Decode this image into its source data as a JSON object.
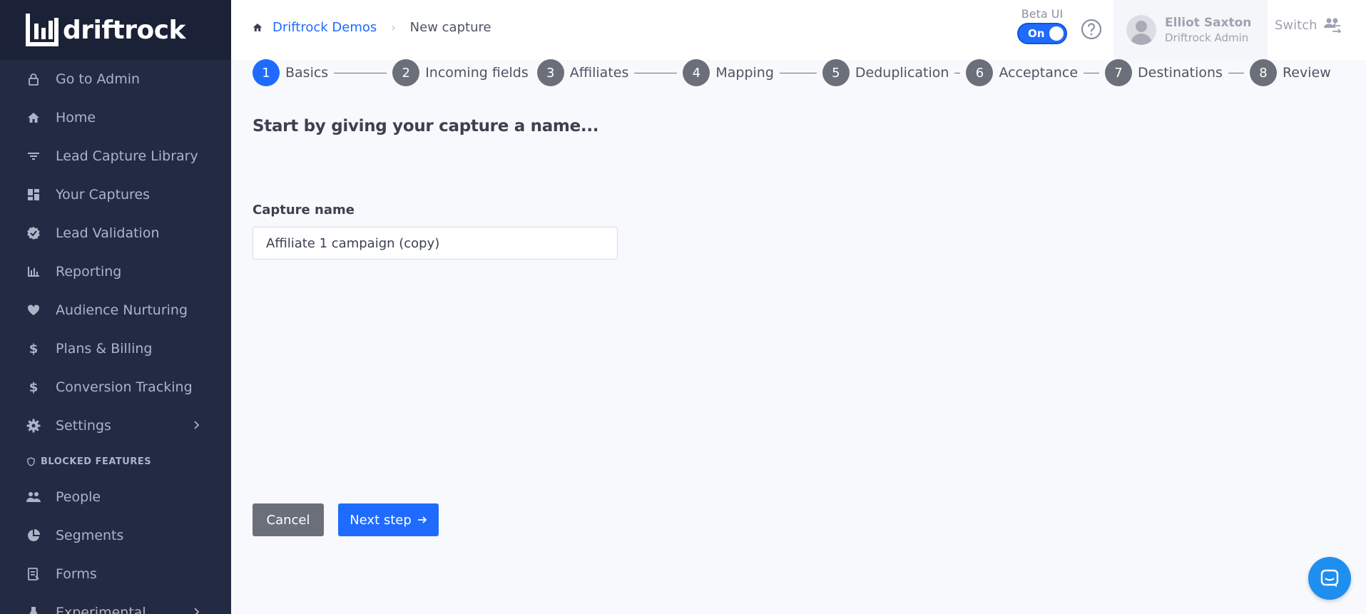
{
  "brand": {
    "name": "driftrock"
  },
  "sidebar": {
    "items": [
      {
        "label": "Go to Admin",
        "icon": "lock-icon"
      },
      {
        "label": "Home",
        "icon": "home-icon"
      },
      {
        "label": "Lead Capture Library",
        "icon": "filter-icon"
      },
      {
        "label": "Your Captures",
        "icon": "dashboard-icon"
      },
      {
        "label": "Lead Validation",
        "icon": "verified-icon"
      },
      {
        "label": "Reporting",
        "icon": "bar-chart-icon"
      },
      {
        "label": "Audience Nurturing",
        "icon": "heart-icon"
      },
      {
        "label": "Plans & Billing",
        "icon": "dollar-icon"
      },
      {
        "label": "Conversion Tracking",
        "icon": "dollar-icon"
      },
      {
        "label": "Settings",
        "icon": "gear-icon"
      }
    ],
    "section_label": "BLOCKED FEATURES",
    "blocked_items": [
      {
        "label": "People",
        "icon": "people-icon"
      },
      {
        "label": "Segments",
        "icon": "pie-chart-icon"
      },
      {
        "label": "Forms",
        "icon": "form-icon"
      },
      {
        "label": "Experimental",
        "icon": "flask-icon"
      }
    ]
  },
  "header": {
    "breadcrumb": {
      "root": "Driftrock Demos",
      "current": "New capture"
    },
    "beta_label": "Beta UI",
    "toggle_label": "On",
    "user": {
      "name": "Elliot Saxton",
      "role": "Driftrock Admin"
    },
    "switch_label": "Switch"
  },
  "stepper": {
    "steps": [
      {
        "num": "1",
        "label": "Basics",
        "active": true
      },
      {
        "num": "2",
        "label": "Incoming fields"
      },
      {
        "num": "3",
        "label": "Affiliates"
      },
      {
        "num": "4",
        "label": "Mapping"
      },
      {
        "num": "5",
        "label": "Deduplication"
      },
      {
        "num": "6",
        "label": "Acceptance"
      },
      {
        "num": "7",
        "label": "Destinations"
      },
      {
        "num": "8",
        "label": "Review"
      }
    ]
  },
  "main": {
    "title": "Start by giving your capture a name...",
    "field_label": "Capture name",
    "field_value": "Affiliate 1 campaign (copy)",
    "cancel_label": "Cancel",
    "next_label": "Next step"
  },
  "colors": {
    "primary": "#1f6bff",
    "sidebar_bg": "#232a44",
    "step_inactive": "#6b6f7a",
    "chat": "#1f8fef"
  }
}
